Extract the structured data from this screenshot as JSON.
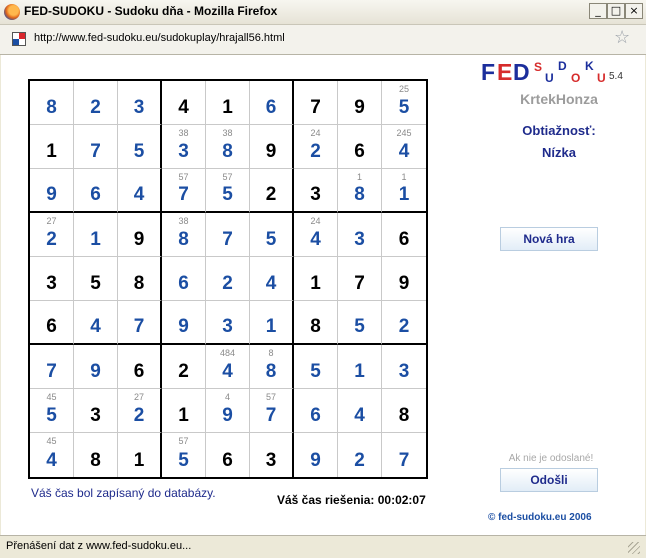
{
  "window": {
    "title": "FED-SUDOKU - Sudoku dňa - Mozilla Firefox",
    "minimize_icon": "minimize-icon",
    "maximize_icon": "maximize-icon",
    "close_icon": "close-icon"
  },
  "address_bar": {
    "url": "http://www.fed-sudoku.eu/sudokuplay/hrajall56.html",
    "favicon": "site-favicon",
    "bookmark_icon": "star-icon"
  },
  "sudoku": {
    "rows": [
      [
        {
          "v": "8",
          "t": "user"
        },
        {
          "v": "2",
          "t": "user"
        },
        {
          "v": "3",
          "t": "user"
        },
        {
          "v": "4",
          "t": "given"
        },
        {
          "v": "1",
          "t": "given"
        },
        {
          "v": "6",
          "t": "user"
        },
        {
          "v": "7",
          "t": "given"
        },
        {
          "v": "9",
          "t": "given"
        },
        {
          "v": "5",
          "t": "user",
          "n": "25"
        }
      ],
      [
        {
          "v": "1",
          "t": "given"
        },
        {
          "v": "7",
          "t": "user"
        },
        {
          "v": "5",
          "t": "user"
        },
        {
          "v": "3",
          "t": "user",
          "n": "38"
        },
        {
          "v": "8",
          "t": "user",
          "n": "38"
        },
        {
          "v": "9",
          "t": "given"
        },
        {
          "v": "2",
          "t": "user",
          "n": "24"
        },
        {
          "v": "6",
          "t": "given"
        },
        {
          "v": "4",
          "t": "user",
          "n": "245"
        }
      ],
      [
        {
          "v": "9",
          "t": "user"
        },
        {
          "v": "6",
          "t": "user"
        },
        {
          "v": "4",
          "t": "user"
        },
        {
          "v": "7",
          "t": "user",
          "n": "57"
        },
        {
          "v": "5",
          "t": "user",
          "n": "57"
        },
        {
          "v": "2",
          "t": "given"
        },
        {
          "v": "3",
          "t": "given"
        },
        {
          "v": "8",
          "t": "user",
          "n": "1"
        },
        {
          "v": "1",
          "t": "user",
          "n": "1"
        }
      ],
      [
        {
          "v": "2",
          "t": "user",
          "n": "27"
        },
        {
          "v": "1",
          "t": "user"
        },
        {
          "v": "9",
          "t": "given"
        },
        {
          "v": "8",
          "t": "user",
          "n": "38"
        },
        {
          "v": "7",
          "t": "user"
        },
        {
          "v": "5",
          "t": "user"
        },
        {
          "v": "4",
          "t": "user",
          "n": "24"
        },
        {
          "v": "3",
          "t": "user"
        },
        {
          "v": "6",
          "t": "given"
        }
      ],
      [
        {
          "v": "3",
          "t": "given"
        },
        {
          "v": "5",
          "t": "given"
        },
        {
          "v": "8",
          "t": "given"
        },
        {
          "v": "6",
          "t": "user"
        },
        {
          "v": "2",
          "t": "user"
        },
        {
          "v": "4",
          "t": "user"
        },
        {
          "v": "1",
          "t": "given"
        },
        {
          "v": "7",
          "t": "given"
        },
        {
          "v": "9",
          "t": "given"
        }
      ],
      [
        {
          "v": "6",
          "t": "given"
        },
        {
          "v": "4",
          "t": "user"
        },
        {
          "v": "7",
          "t": "user"
        },
        {
          "v": "9",
          "t": "user"
        },
        {
          "v": "3",
          "t": "user"
        },
        {
          "v": "1",
          "t": "user"
        },
        {
          "v": "8",
          "t": "given"
        },
        {
          "v": "5",
          "t": "user"
        },
        {
          "v": "2",
          "t": "user"
        }
      ],
      [
        {
          "v": "7",
          "t": "user"
        },
        {
          "v": "9",
          "t": "user"
        },
        {
          "v": "6",
          "t": "given"
        },
        {
          "v": "2",
          "t": "given"
        },
        {
          "v": "4",
          "t": "user",
          "n": "484"
        },
        {
          "v": "8",
          "t": "user",
          "n": "8"
        },
        {
          "v": "5",
          "t": "user"
        },
        {
          "v": "1",
          "t": "user"
        },
        {
          "v": "3",
          "t": "user"
        }
      ],
      [
        {
          "v": "5",
          "t": "user",
          "n": "45"
        },
        {
          "v": "3",
          "t": "given"
        },
        {
          "v": "2",
          "t": "user",
          "n": "27"
        },
        {
          "v": "1",
          "t": "given"
        },
        {
          "v": "9",
          "t": "user",
          "n": "4"
        },
        {
          "v": "7",
          "t": "user",
          "n": "57"
        },
        {
          "v": "6",
          "t": "user"
        },
        {
          "v": "4",
          "t": "user"
        },
        {
          "v": "8",
          "t": "given"
        }
      ],
      [
        {
          "v": "4",
          "t": "user",
          "n": "45"
        },
        {
          "v": "8",
          "t": "given"
        },
        {
          "v": "1",
          "t": "given"
        },
        {
          "v": "5",
          "t": "user",
          "n": "57"
        },
        {
          "v": "6",
          "t": "given"
        },
        {
          "v": "3",
          "t": "given"
        },
        {
          "v": "9",
          "t": "user"
        },
        {
          "v": "2",
          "t": "user"
        },
        {
          "v": "7",
          "t": "user"
        }
      ]
    ],
    "colors": {
      "user": "#1b4ea3",
      "given": "#000000",
      "note": "#8a8a8a"
    }
  },
  "messages": {
    "saved": "Váš čas bol zapísaný do databázy.",
    "solve_time": "Váš čas riešenia: 00:02:07"
  },
  "sidebar": {
    "logo": {
      "big": [
        "F",
        "E",
        "D"
      ],
      "small": [
        "S",
        "U",
        "D",
        "O",
        "K",
        "U"
      ],
      "version": "5.4"
    },
    "username": "KrtekHonza",
    "difficulty_label": "Obtiažnosť:",
    "difficulty_value": "Nízka",
    "new_game_button": "Nová hra",
    "not_sent_hint": "Ak nie je odoslané!",
    "send_button": "Odošli",
    "copyright": "© fed-sudoku.eu 2006"
  },
  "status_bar": {
    "text": "Přenášení dat z www.fed-sudoku.eu..."
  }
}
